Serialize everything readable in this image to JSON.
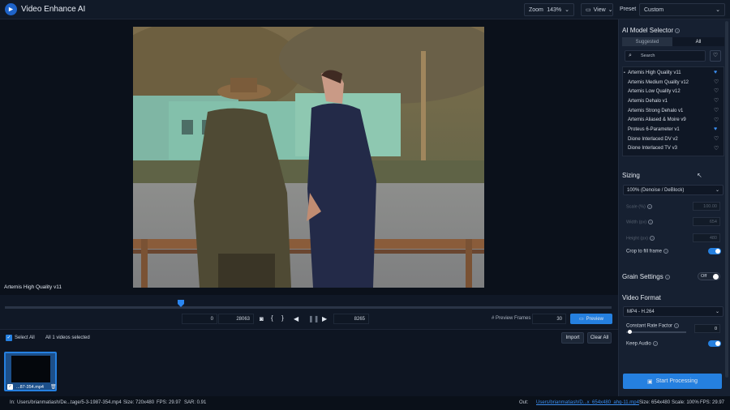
{
  "app": {
    "title": "Video Enhance AI"
  },
  "toolbar": {
    "zoom_label": "Zoom",
    "zoom_value": "143%",
    "view_label": "View",
    "preset_label": "Preset",
    "preset_value": "Custom"
  },
  "viewer": {
    "model_caption": "Artemis High Quality v11"
  },
  "timeline": {
    "start_frame": "0",
    "end_frame": "28063",
    "current_frame": "8265",
    "preview_frames_label": "# Preview Frames",
    "preview_frames_value": "30",
    "preview_button": "Preview",
    "playhead_fraction": 0.29
  },
  "files": {
    "select_all": "Select All",
    "selected_text": "All 1 videos selected",
    "import_button": "Import",
    "clear_button": "Clear All",
    "thumb_label": "...87-354.mp4"
  },
  "model_selector": {
    "title": "AI Model Selector",
    "tab_suggested": "Suggested",
    "tab_all": "All",
    "search_placeholder": "Search",
    "models": [
      {
        "name": "Artemis High Quality v11",
        "fav": true,
        "active": true
      },
      {
        "name": "Artemis Medium Quality v12",
        "fav": false
      },
      {
        "name": "Artemis Low Quality v12",
        "fav": false
      },
      {
        "name": "Artemis Dehalo v1",
        "fav": false
      },
      {
        "name": "Artemis Strong Dehalo v1",
        "fav": false
      },
      {
        "name": "Artemis Aliased & Moire v9",
        "fav": false
      },
      {
        "name": "Proteus 6-Parameter v1",
        "fav": true
      },
      {
        "name": "Dione Interlaced DV v2",
        "fav": false
      },
      {
        "name": "Dione Interlaced TV v3",
        "fav": false
      }
    ]
  },
  "sizing": {
    "title": "Sizing",
    "preset": "100% (Denoise / DeBlock)",
    "scale_label": "Scale (%)",
    "scale_value": "100.00",
    "width_label": "Width (px)",
    "width_value": "654",
    "height_label": "Height (px)",
    "height_value": "480",
    "crop_label": "Crop to fill frame"
  },
  "grain": {
    "title": "Grain Settings",
    "toggle_text": "Off"
  },
  "video_format": {
    "title": "Video Format",
    "format": "MP4 - H.264",
    "crf_label": "Constant Rate Factor",
    "crf_value": "0",
    "audio_label": "Keep Audio"
  },
  "process": {
    "button": "Start Processing"
  },
  "status": {
    "in_label": "In:",
    "in_path": "Users/brianmatiash/De...tage/5-3-1987-354.mp4",
    "in_size": "Size: 720x480",
    "in_fps": "FPS: 29.97",
    "in_sar": "SAR: 0.91",
    "out_label": "Out:",
    "out_path": "Users/brianmatiash/D...x_654x480_ahq-11.mp4",
    "out_size": "Size: 654x480",
    "out_scale": "Scale: 100%",
    "out_fps": "FPS: 29.97"
  }
}
